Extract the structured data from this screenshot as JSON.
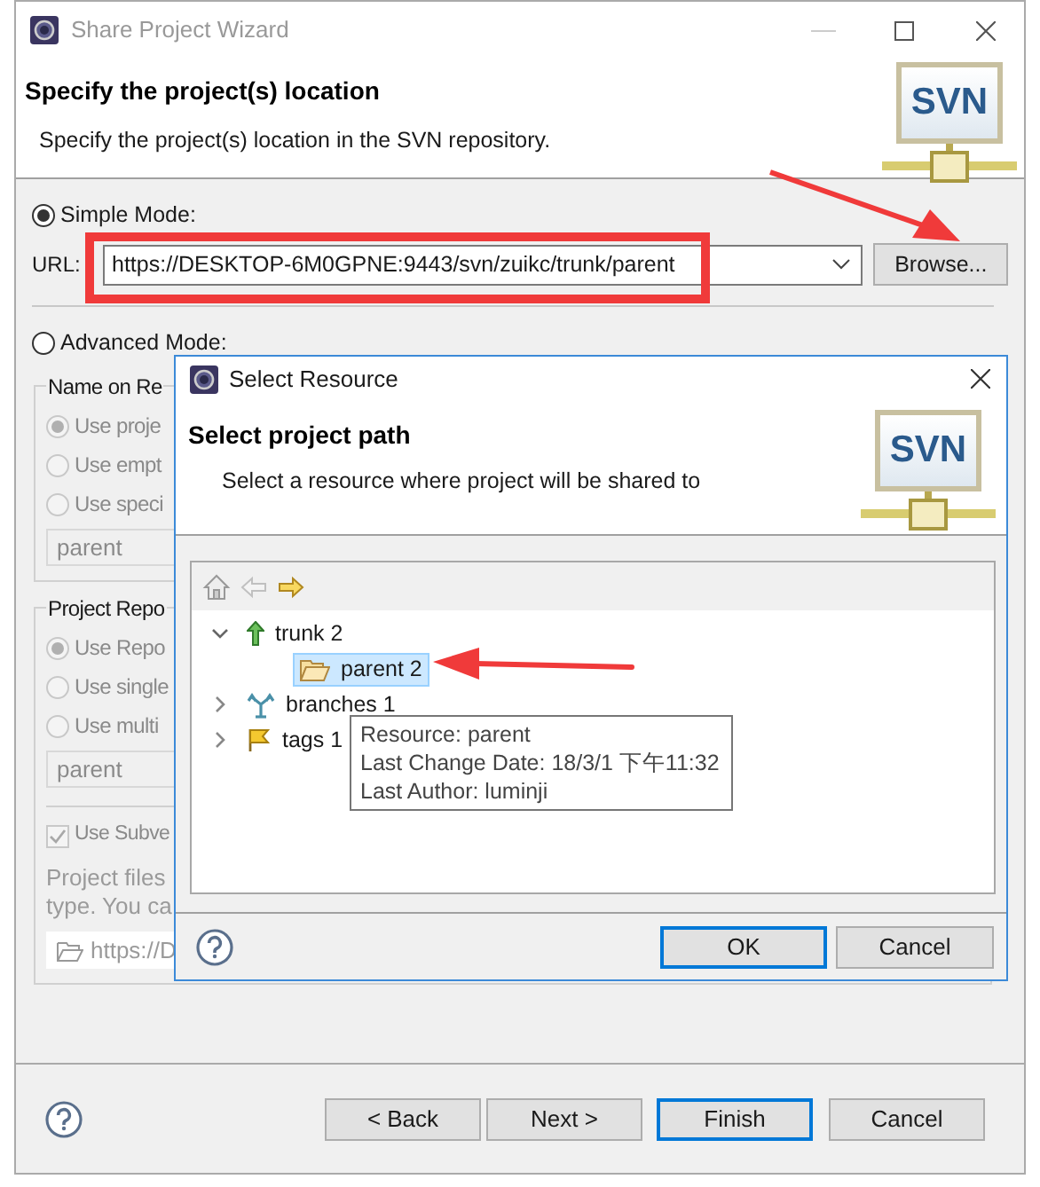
{
  "window": {
    "title": "Share Project Wizard"
  },
  "header": {
    "title": "Specify the project(s) location",
    "description": "Specify the project(s) location in the SVN repository.",
    "logo_text": "SVN"
  },
  "modes": [
    {
      "label": "Simple Mode:",
      "selected": true
    },
    {
      "label": "Advanced Mode:",
      "selected": false
    }
  ],
  "url": {
    "label": "URL:",
    "value": "https://DESKTOP-6M0GPNE:9443/svn/zuikc/trunk/parent"
  },
  "browse_button": "Browse...",
  "name_group": {
    "title": "Name on Re",
    "disabled": true,
    "options": [
      {
        "label": "Use proje",
        "selected": true
      },
      {
        "label": "Use empt",
        "selected": false
      },
      {
        "label": "Use speci",
        "selected": false
      }
    ],
    "value": "parent"
  },
  "repo_group": {
    "title": "Project Repo",
    "disabled": true,
    "options": [
      {
        "label": "Use Repo",
        "selected": true
      },
      {
        "label": "Use single",
        "selected": false
      },
      {
        "label": "Use multi",
        "selected": false
      }
    ],
    "value": "parent",
    "checkbox": {
      "label": "Use Subve",
      "checked": true
    },
    "note": [
      "Project files",
      "type. You ca"
    ],
    "location": "https://D"
  },
  "dialog": {
    "title": "Select Resource",
    "header": {
      "title": "Select project path",
      "description": "Select a resource where project will be shared to",
      "logo_text": "SVN"
    },
    "tree": [
      {
        "label": "trunk 2",
        "kind": "trunk",
        "expanded": true,
        "selected": false,
        "children": [
          {
            "label": "parent 2",
            "kind": "folder",
            "selected": true
          }
        ]
      },
      {
        "label": "branches 1",
        "kind": "branches",
        "expanded": false,
        "selected": false
      },
      {
        "label": "tags 1",
        "kind": "tags",
        "expanded": false,
        "selected": false
      }
    ],
    "tooltip": [
      "Resource: parent",
      "Last Change Date: 18/3/1 下午11:32",
      "Last Author: luminji"
    ],
    "buttons": [
      {
        "label": "OK",
        "default": true
      },
      {
        "label": "Cancel",
        "default": false
      }
    ]
  },
  "buttons": [
    {
      "label": "< Back",
      "default": false
    },
    {
      "label": "Next >",
      "default": false
    },
    {
      "label": "Finish",
      "default": true
    },
    {
      "label": "Cancel",
      "default": false
    }
  ]
}
